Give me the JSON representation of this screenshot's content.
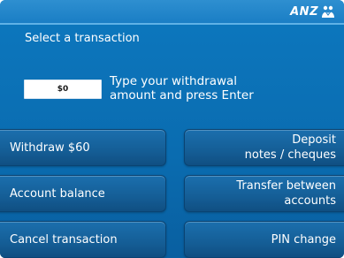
{
  "brand": {
    "name": "ANZ"
  },
  "header": {
    "title": "Select a transaction"
  },
  "amount": {
    "value": "$0"
  },
  "instruction": {
    "line1": "Type your withdrawal",
    "line2": "amount and press Enter"
  },
  "buttons": {
    "left": [
      {
        "label": "Withdraw $60"
      },
      {
        "label": "Account balance"
      },
      {
        "label": "Cancel transaction"
      }
    ],
    "right": [
      {
        "line1": "Deposit",
        "line2": "notes / cheques"
      },
      {
        "line1": "Transfer between",
        "line2": "accounts"
      },
      {
        "line1": "PIN change"
      }
    ]
  },
  "colors": {
    "screen_blue": "#0a6cb0",
    "button_blue": "#155f98",
    "accent_light": "#5fb2e6"
  }
}
